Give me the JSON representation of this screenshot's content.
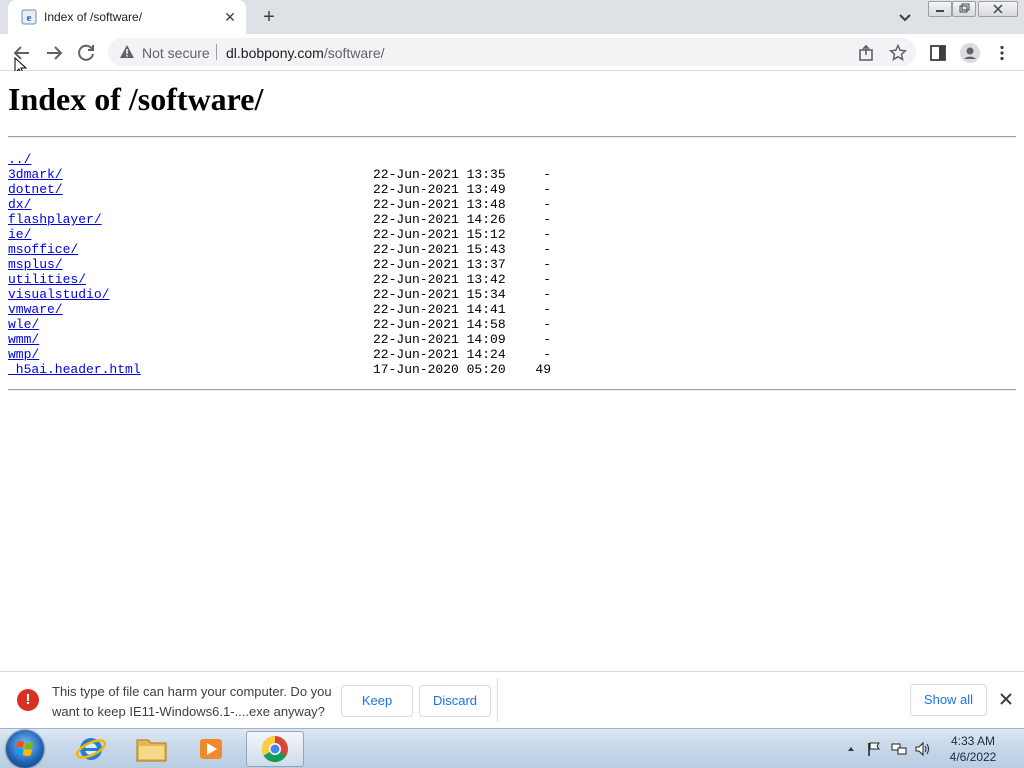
{
  "browser": {
    "tab": {
      "title": "Index of /software/",
      "close_glyph": "✕"
    },
    "new_tab_glyph": "+",
    "security_label": "Not secure",
    "url_host": "dl.bobpony.com",
    "url_path": "/software/"
  },
  "page": {
    "heading": "Index of /software/",
    "entries": [
      {
        "name": "../",
        "date": "",
        "size": ""
      },
      {
        "name": "3dmark/",
        "date": "22-Jun-2021 13:35",
        "size": "-"
      },
      {
        "name": "dotnet/",
        "date": "22-Jun-2021 13:49",
        "size": "-"
      },
      {
        "name": "dx/",
        "date": "22-Jun-2021 13:48",
        "size": "-"
      },
      {
        "name": "flashplayer/",
        "date": "22-Jun-2021 14:26",
        "size": "-"
      },
      {
        "name": "ie/",
        "date": "22-Jun-2021 15:12",
        "size": "-"
      },
      {
        "name": "msoffice/",
        "date": "22-Jun-2021 15:43",
        "size": "-"
      },
      {
        "name": "msplus/",
        "date": "22-Jun-2021 13:37",
        "size": "-"
      },
      {
        "name": "utilities/",
        "date": "22-Jun-2021 13:42",
        "size": "-"
      },
      {
        "name": "visualstudio/",
        "date": "22-Jun-2021 15:34",
        "size": "-"
      },
      {
        "name": "vmware/",
        "date": "22-Jun-2021 14:41",
        "size": "-"
      },
      {
        "name": "wle/",
        "date": "22-Jun-2021 14:58",
        "size": "-"
      },
      {
        "name": "wmm/",
        "date": "22-Jun-2021 14:09",
        "size": "-"
      },
      {
        "name": "wmp/",
        "date": "22-Jun-2021 14:24",
        "size": "-"
      },
      {
        "name": "_h5ai.header.html",
        "date": "17-Jun-2020 05:20",
        "size": "49"
      }
    ]
  },
  "download_bar": {
    "message": "This type of file can harm your computer. Do you want to keep IE11-Windows6.1-....exe anyway?",
    "keep_label": "Keep",
    "discard_label": "Discard",
    "show_all_label": "Show all",
    "warning_glyph": "!"
  },
  "taskbar": {
    "time": "4:33 AM",
    "date": "4/6/2022"
  },
  "colors": {
    "link": "#0000ee",
    "accent": "#1a73e8",
    "danger": "#d93025"
  }
}
